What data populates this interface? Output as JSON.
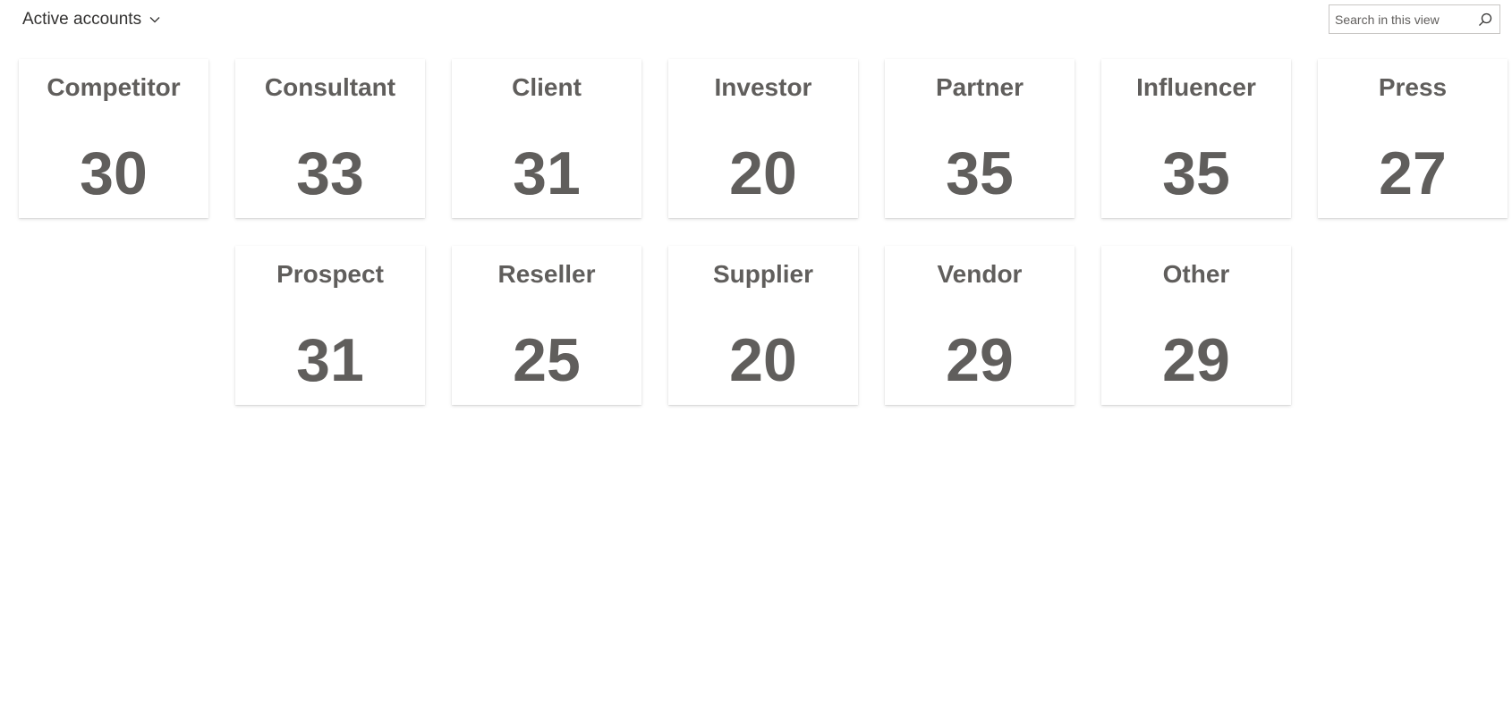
{
  "header": {
    "view_title": "Active accounts",
    "search_placeholder": "Search in this view"
  },
  "tiles": [
    {
      "label": "Competitor",
      "count": "30"
    },
    {
      "label": "Consultant",
      "count": "33"
    },
    {
      "label": "Client",
      "count": "31"
    },
    {
      "label": "Investor",
      "count": "20"
    },
    {
      "label": "Partner",
      "count": "35"
    },
    {
      "label": "Influencer",
      "count": "35"
    },
    {
      "label": "Press",
      "count": "27"
    },
    {
      "label": "Prospect",
      "count": "31"
    },
    {
      "label": "Reseller",
      "count": "25"
    },
    {
      "label": "Supplier",
      "count": "20"
    },
    {
      "label": "Vendor",
      "count": "29"
    },
    {
      "label": "Other",
      "count": "29"
    }
  ]
}
